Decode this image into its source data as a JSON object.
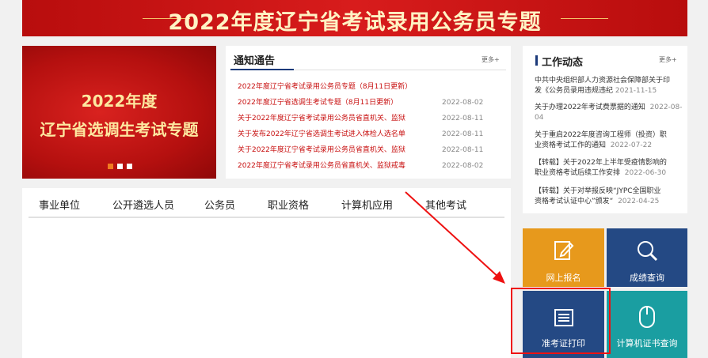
{
  "banner": {
    "title": "2022年度辽宁省考试录用公务员专题"
  },
  "promo": {
    "line1": "2022年度",
    "line2": "辽宁省选调生考试专题"
  },
  "notice": {
    "title": "通知通告",
    "more": "更多+",
    "items": [
      {
        "title": "2022年度辽宁省考试录用公务员专题（8月11日更新）",
        "date": ""
      },
      {
        "title": "2022年度辽宁省选调生考试专题（8月11日更新）",
        "date": "2022-08-02"
      },
      {
        "title": "关于2022年度辽宁省考试录用公务员省直机关、监狱",
        "date": "2022-08-11"
      },
      {
        "title": "关于发布2022年辽宁省选调生考试进入体检人选名单",
        "date": "2022-08-11"
      },
      {
        "title": "关于2022年度辽宁省考试录用公务员省直机关、监狱",
        "date": "2022-08-11"
      },
      {
        "title": "2022年度辽宁省考试录用公务员省直机关、监狱戒毒",
        "date": "2022-08-02"
      }
    ]
  },
  "tabs": [
    "事业单位",
    "公开遴选人员",
    "公务员",
    "职业资格",
    "计算机应用",
    "其他考试"
  ],
  "work": {
    "title": "工作动态",
    "more": "更多+",
    "items": [
      {
        "l1": "中共中央组织部人力资源社会保障部关于印",
        "l2": "发《公务员录用违规违纪",
        "date": "2021-11-15"
      },
      {
        "l1": "关于办理2022年考试费票据的通知",
        "l2": "",
        "date": "2022-08-04"
      },
      {
        "l1": "关于重启2022年度咨询工程师（投资）职",
        "l2": "业资格考试工作的通知",
        "date": "2022-07-22"
      },
      {
        "l1": "【转载】关于2022年上半年受疫情影响的",
        "l2": "职业资格考试后续工作安排",
        "date": "2022-06-30"
      },
      {
        "l1": "【转载】关于对举报反映“JYPC全国职业",
        "l2": "资格考试认证中心”颁发“",
        "date": "2022-04-25"
      }
    ]
  },
  "tiles": {
    "register": "网上报名",
    "score": "成绩查询",
    "admit": "准考证打印",
    "cert": "计算机证书查询"
  },
  "colors": {
    "red": "#c81010",
    "navy": "#244984",
    "orange": "#e7991c",
    "teal": "#1a9ea1"
  }
}
